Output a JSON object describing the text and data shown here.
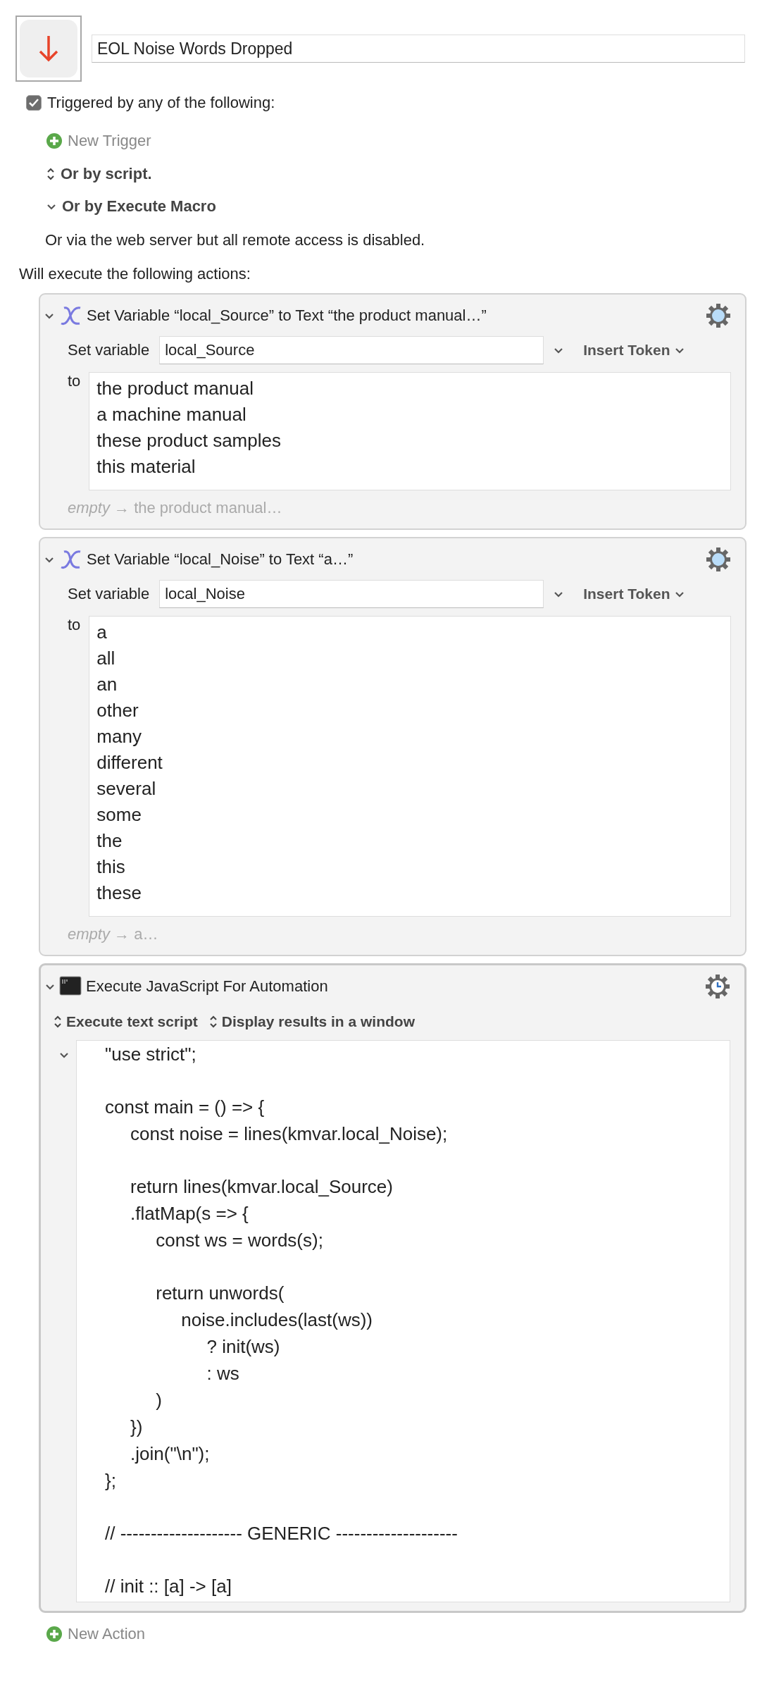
{
  "macro": {
    "name": "EOL Noise Words Dropped"
  },
  "triggers": {
    "label": "Triggered by any of the following:",
    "checked": true,
    "new_trigger": "New Trigger",
    "options": [
      {
        "kind": "popup",
        "label": "Or by script."
      },
      {
        "kind": "disclosure",
        "label": "Or by Execute Macro",
        "expanded": true
      }
    ],
    "web_note": "Or via the web server but all remote access is disabled."
  },
  "actions_heading": "Will execute the following actions:",
  "actions": [
    {
      "kind": "set_variable",
      "expanded": true,
      "title": "Set Variable “local_Source” to Text “the product manual…”",
      "variable_label": "Set variable",
      "variable": "local_Source",
      "insert_token": "Insert Token",
      "to_label": "to",
      "lines": [
        "the product manual",
        "a machine manual",
        "these product samples",
        "this material"
      ],
      "preview": "*empty* → the product manual…"
    },
    {
      "kind": "set_variable",
      "expanded": true,
      "title": "Set Variable “local_Noise” to Text “a…”",
      "variable_label": "Set variable",
      "variable": "local_Noise",
      "insert_token": "Insert Token",
      "to_label": "to",
      "lines": [
        "a",
        "all",
        "an",
        "other",
        "many",
        "different",
        "several",
        "some",
        "the",
        "this",
        "these"
      ],
      "preview": "*empty* → a…"
    },
    {
      "kind": "script",
      "expanded": true,
      "title": "Execute JavaScript For Automation",
      "options": [
        "Execute text script",
        "Display results in a window"
      ],
      "blocks": [
        [
          "\"use strict\";"
        ],
        [
          "const main = () => {",
          "     const noise = lines(kmvar.local_Noise);"
        ],
        [
          "     return lines(kmvar.local_Source)",
          "     .flatMap(s => {",
          "          const ws = words(s);"
        ],
        [
          "          return unwords(",
          "               noise.includes(last(ws))",
          "                    ? init(ws)",
          "                    : ws",
          "          )",
          "     })",
          "     .join(\"\\n\");",
          "};"
        ],
        [
          "// -------------------- GENERIC --------------------"
        ],
        [
          "// init :: [a] -> [a]"
        ]
      ]
    }
  ],
  "new_action": "New Action"
}
